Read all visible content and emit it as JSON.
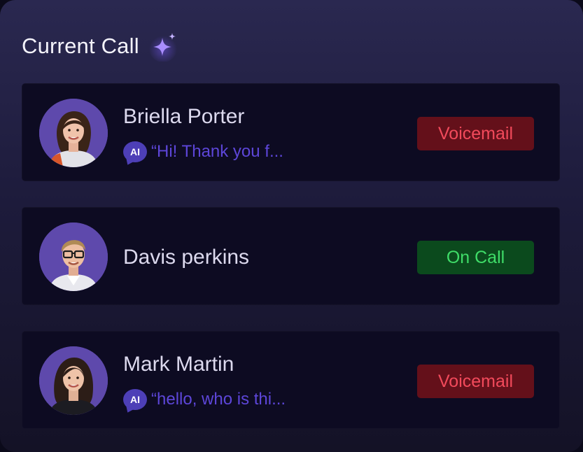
{
  "header": {
    "title": "Current Call",
    "icon": "sparkle-icon"
  },
  "colors": {
    "accent": "#5d46d9",
    "voicemail_bg": "#64101a",
    "voicemail_text": "#f24a5b",
    "oncall_bg": "#0b4a1d",
    "oncall_text": "#3fdc68"
  },
  "calls": [
    {
      "name": "Briella Porter",
      "ai_label": "AI",
      "quote": "“Hi! Thank you f...",
      "status": "Voicemail"
    },
    {
      "name": "Davis perkins",
      "status": "On Call"
    },
    {
      "name": "Mark Martin",
      "ai_label": "AI",
      "quote": "“hello, who is thi...",
      "status": "Voicemail"
    }
  ]
}
